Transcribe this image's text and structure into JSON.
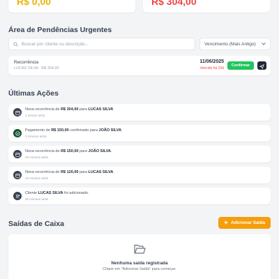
{
  "stats": {
    "left_value": "R$ 0,00",
    "right_value": "R$ 304,00"
  },
  "pending": {
    "section_title": "Área de Pendências Urgentes",
    "search_placeholder": "Buscar por cliente ou descrição...",
    "sort_selected": "Vencimento (Mais Antigo)",
    "items": [
      {
        "title": "Recorrência",
        "subtitle": "LUCAS SILVA - R$ 304,00",
        "date": "11/06/2025",
        "due_label": "Vencido há 23d",
        "confirm_label": "Confirmar"
      }
    ]
  },
  "actions": {
    "section_title": "Últimas Ações",
    "items": [
      {
        "icon": "calendar-icon",
        "pre": "Nova recorrência de ",
        "amount": "R$ 304,00",
        "mid": " para ",
        "name": "LUCAS SILVA",
        "post": "",
        "time": "1 minuto atrás"
      },
      {
        "icon": "check-circle-icon",
        "pre": "Pagamento de ",
        "amount": "R$ 150,00",
        "mid": " confirmado para ",
        "name": "JOÃO SILVA",
        "post": ".",
        "time": "3 minutos atrás"
      },
      {
        "icon": "calendar-icon",
        "pre": "Nova recorrência de ",
        "amount": "R$ 150,00",
        "mid": " para ",
        "name": "JOÃO SILVA",
        "post": ".",
        "time": "28 minutos atrás"
      },
      {
        "icon": "calendar-icon",
        "pre": "Nova recorrência de ",
        "amount": "R$ 120,00",
        "mid": " para ",
        "name": "LUCAS SILVA",
        "post": ".",
        "time": "34 minutos atrás"
      },
      {
        "icon": "user-plus-icon",
        "pre": "Cliente ",
        "amount": "LUCAS SILVA",
        "mid": " foi adicionado.",
        "name": "",
        "post": "",
        "time": "55 minutos atrás"
      }
    ]
  },
  "cash_out": {
    "section_title": "Saídas de Caixa",
    "add_label": "Adicionar Saída",
    "empty_title": "Nenhuma saída registrada",
    "empty_hint": "Clique em \"Adicionar Saída\" para começar."
  },
  "colors": {
    "accent": "#f59e0b",
    "success": "#22c55e",
    "danger": "#ef4444",
    "warning": "#eab308"
  }
}
